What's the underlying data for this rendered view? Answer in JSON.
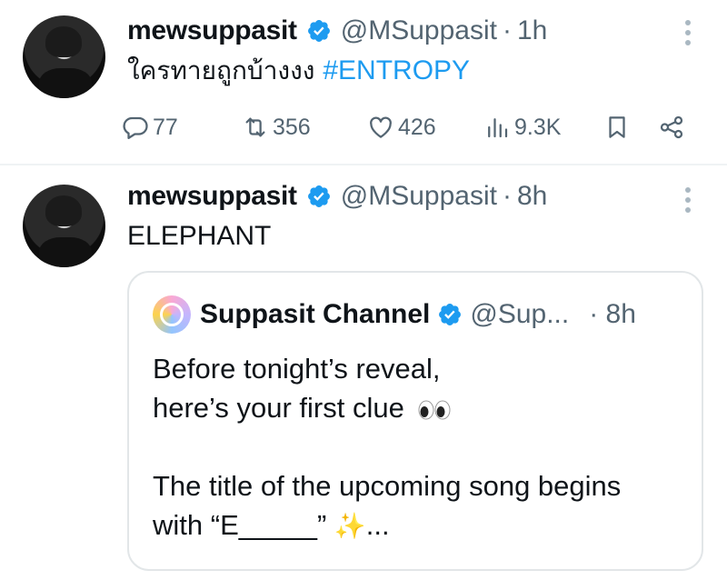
{
  "tweets": [
    {
      "name": "mewsuppasit",
      "handle": "@MSuppasit",
      "separator": "·",
      "time": "1h",
      "text_thai": "ใครทายถูกบ้างงง",
      "hashtag": "#ENTROPY",
      "stats": {
        "replies": "77",
        "reposts": "356",
        "likes": "426",
        "views": "9.3K"
      }
    },
    {
      "name": "mewsuppasit",
      "handle": "@MSuppasit",
      "separator": "·",
      "time": "8h",
      "text": "ELEPHANT",
      "quote": {
        "name": "Suppasit Channel",
        "handle": "@Sup...",
        "time": "· 8h",
        "lines": [
          "Before tonight’s reveal,",
          "here’s your first clue",
          "The title of the upcoming song begins",
          "with “E_____”",
          "..."
        ]
      }
    }
  ],
  "colors": {
    "link": "#1d9bf0",
    "muted": "#536471",
    "text": "#0f1419",
    "divider": "#eff3f4"
  },
  "icons": [
    "verified-badge-icon",
    "reply-icon",
    "repost-icon",
    "like-icon",
    "views-icon",
    "bookmark-icon",
    "share-icon",
    "more-icon",
    "eyes-emoji-icon",
    "sparkles-emoji-icon"
  ]
}
